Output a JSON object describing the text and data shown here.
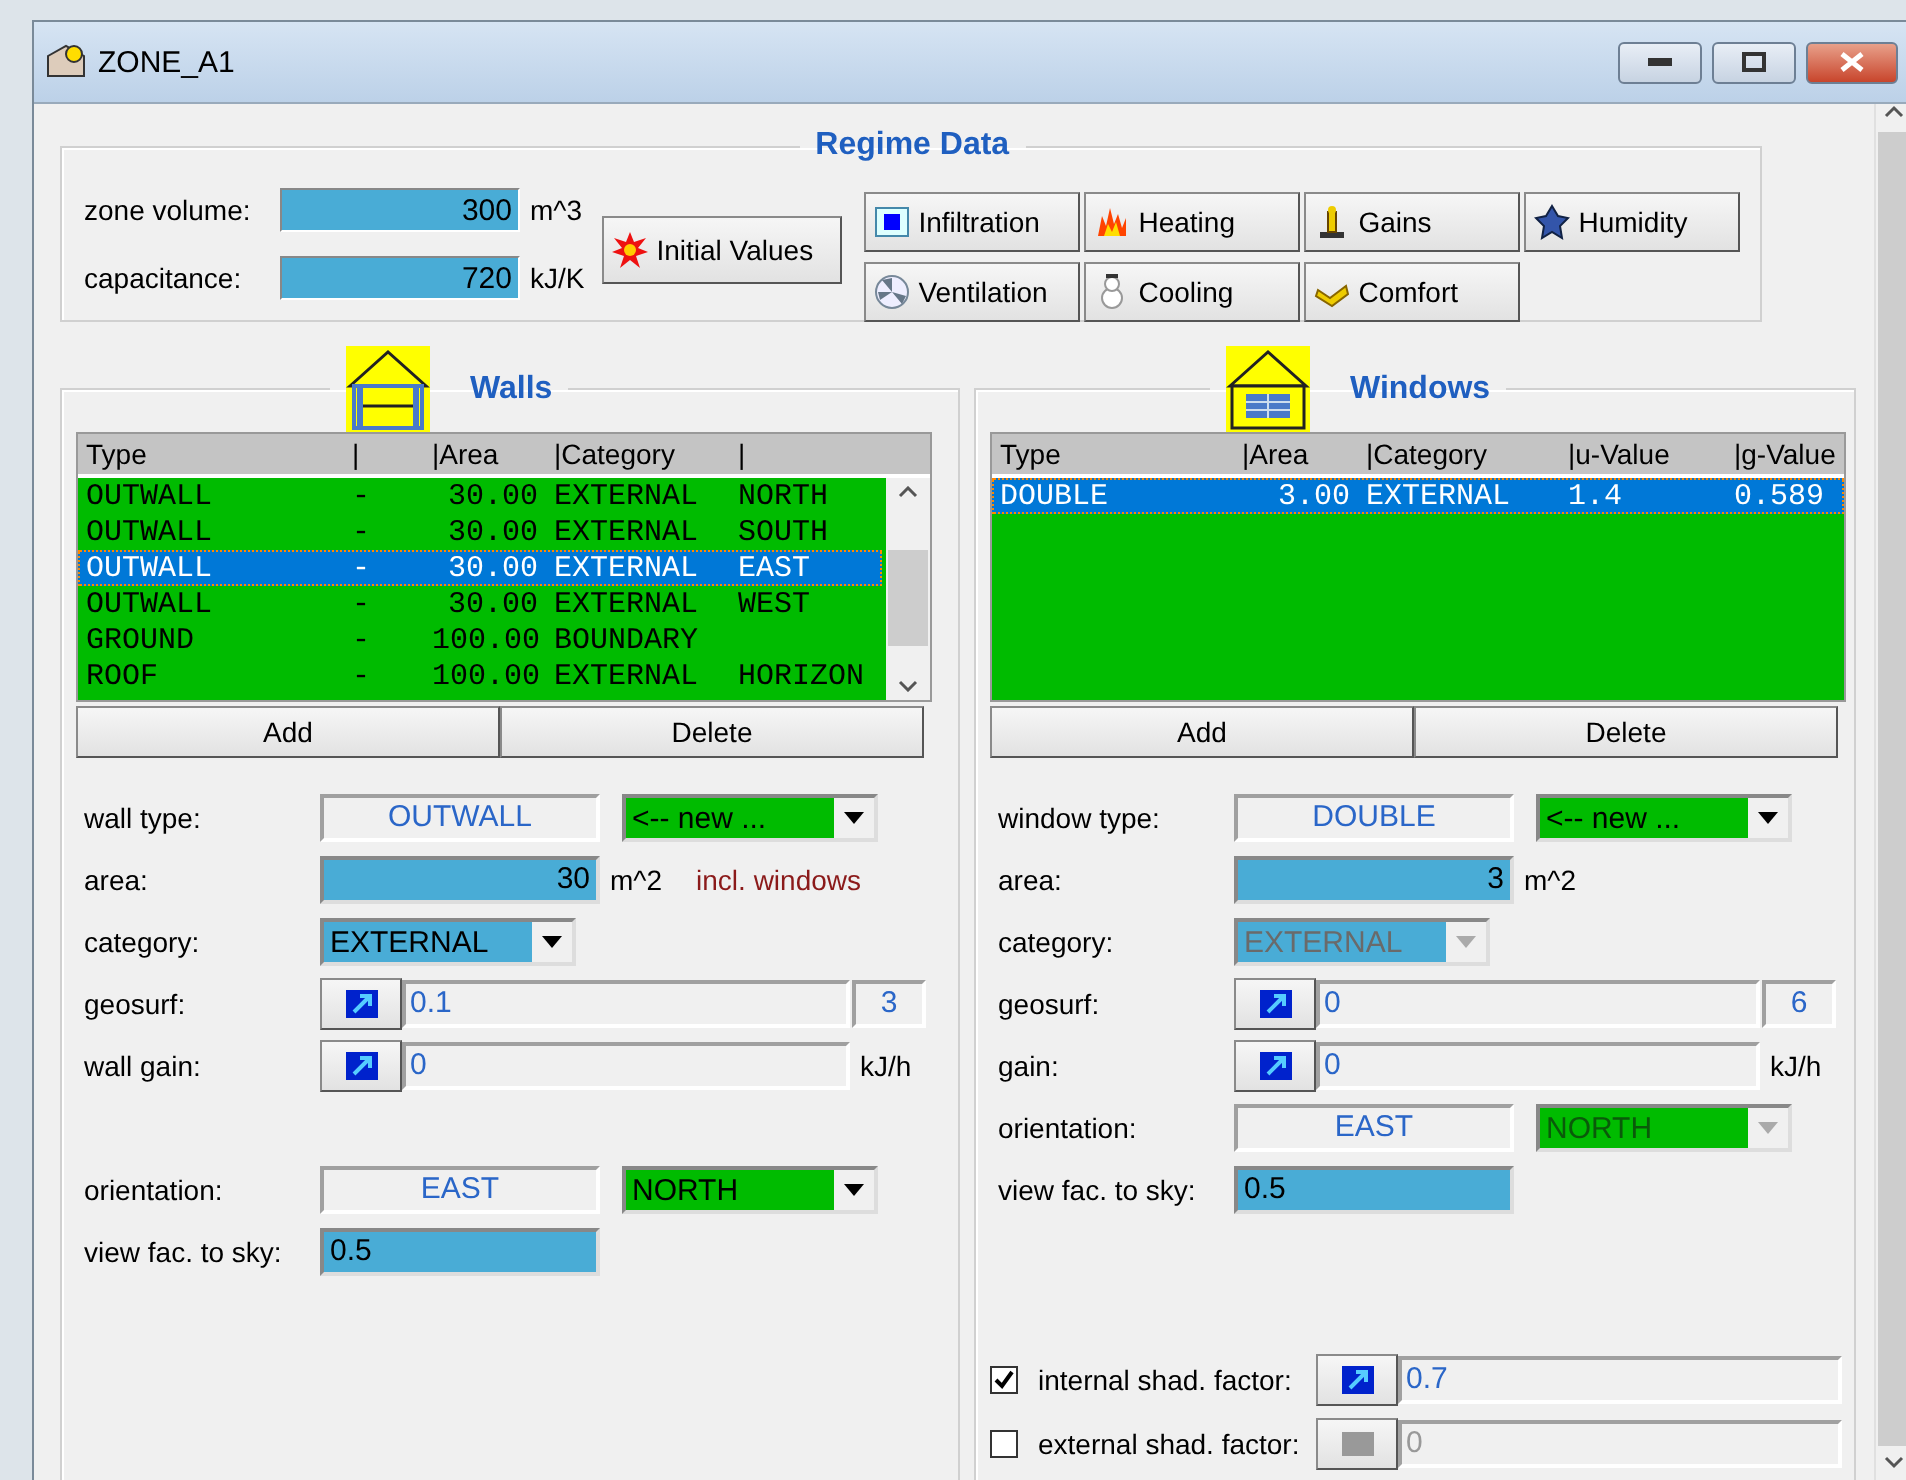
{
  "window": {
    "title": "ZONE_A1"
  },
  "regime": {
    "title": "Regime Data",
    "fields": [
      {
        "label": "zone volume:",
        "value": "300",
        "unit": "m^3"
      },
      {
        "label": "capacitance:",
        "value": "720",
        "unit": "kJ/K"
      }
    ],
    "initial_values": "Initial Values",
    "buttons": [
      {
        "label": "Infiltration",
        "kind": "infiltration"
      },
      {
        "label": "Heating",
        "kind": "heating"
      },
      {
        "label": "Gains",
        "kind": "gains"
      },
      {
        "label": "Humidity",
        "kind": "humidity"
      },
      {
        "label": "Ventilation",
        "kind": "ventilation"
      },
      {
        "label": "Cooling",
        "kind": "cooling"
      },
      {
        "label": "Comfort",
        "kind": "comfort"
      }
    ]
  },
  "walls": {
    "title": "Walls",
    "columns": [
      "Type",
      "|",
      "|Area",
      "|Category",
      "|"
    ],
    "rows": [
      {
        "cells": [
          "OUTWALL",
          "-",
          "30.00",
          "EXTERNAL",
          "NORTH"
        ],
        "selected": false
      },
      {
        "cells": [
          "OUTWALL",
          "-",
          "30.00",
          "EXTERNAL",
          "SOUTH"
        ],
        "selected": false
      },
      {
        "cells": [
          "OUTWALL",
          "-",
          "30.00",
          "EXTERNAL",
          "EAST"
        ],
        "selected": true
      },
      {
        "cells": [
          "OUTWALL",
          "-",
          "30.00",
          "EXTERNAL",
          "WEST"
        ],
        "selected": false
      },
      {
        "cells": [
          "GROUND",
          "-",
          "100.00",
          "BOUNDARY"
        ],
        "selected": false
      },
      {
        "cells": [
          "ROOF",
          "-",
          "100.00",
          "EXTERNAL",
          "HORIZON"
        ],
        "selected": false
      }
    ],
    "add": "Add",
    "delete": "Delete",
    "form": [
      {
        "kind": "type",
        "label": "wall type:",
        "value": "OUTWALL",
        "combo": {
          "value": "<-- new ...",
          "disabled": false
        }
      },
      {
        "kind": "area",
        "label": "area:",
        "value": "30",
        "unit": "m^2",
        "note": "incl. windows"
      },
      {
        "kind": "category",
        "label": "category:",
        "combo": {
          "value": "EXTERNAL",
          "disabled": false
        }
      },
      {
        "kind": "link",
        "label": "geosurf:",
        "value": "0.1",
        "extra": "3"
      },
      {
        "kind": "link",
        "label": "wall gain:",
        "value": "0",
        "unit": "kJ/h"
      }
    ],
    "form_lower": [
      {
        "kind": "type",
        "label": "orientation:",
        "value": "EAST",
        "combo": {
          "value": "NORTH",
          "disabled": false
        }
      },
      {
        "kind": "plain",
        "label": "view fac. to sky:",
        "value": "0.5"
      }
    ]
  },
  "windows": {
    "title": "Windows",
    "columns": [
      "Type",
      "|Area",
      "|Category",
      "|u-Value",
      "|g-Value"
    ],
    "rows": [
      {
        "cells": [
          "DOUBLE",
          "3.00",
          "EXTERNAL",
          "1.4",
          "0.589"
        ],
        "selected": true
      }
    ],
    "add": "Add",
    "delete": "Delete",
    "form": [
      {
        "kind": "type",
        "label": "window type:",
        "value": "DOUBLE",
        "combo": {
          "value": "<-- new ...",
          "disabled": false
        }
      },
      {
        "kind": "area",
        "label": "area:",
        "value": "3",
        "unit": "m^2"
      },
      {
        "kind": "category",
        "label": "category:",
        "combo": {
          "value": "EXTERNAL",
          "disabled": true
        }
      },
      {
        "kind": "link",
        "label": "geosurf:",
        "value": "0",
        "extra": "6"
      },
      {
        "kind": "link",
        "label": "gain:",
        "value": "0",
        "unit": "kJ/h"
      },
      {
        "kind": "type",
        "label": "orientation:",
        "value": "EAST",
        "combo": {
          "value": "NORTH",
          "disabled": true
        }
      },
      {
        "kind": "plain",
        "label": "view fac. to sky:",
        "value": "0.5"
      }
    ],
    "checks": [
      {
        "label": "internal shad. factor:",
        "checked": true,
        "value": "0.7",
        "disabled": false
      },
      {
        "label": "external shad. factor:",
        "checked": false,
        "value": "0",
        "disabled": true
      }
    ]
  }
}
